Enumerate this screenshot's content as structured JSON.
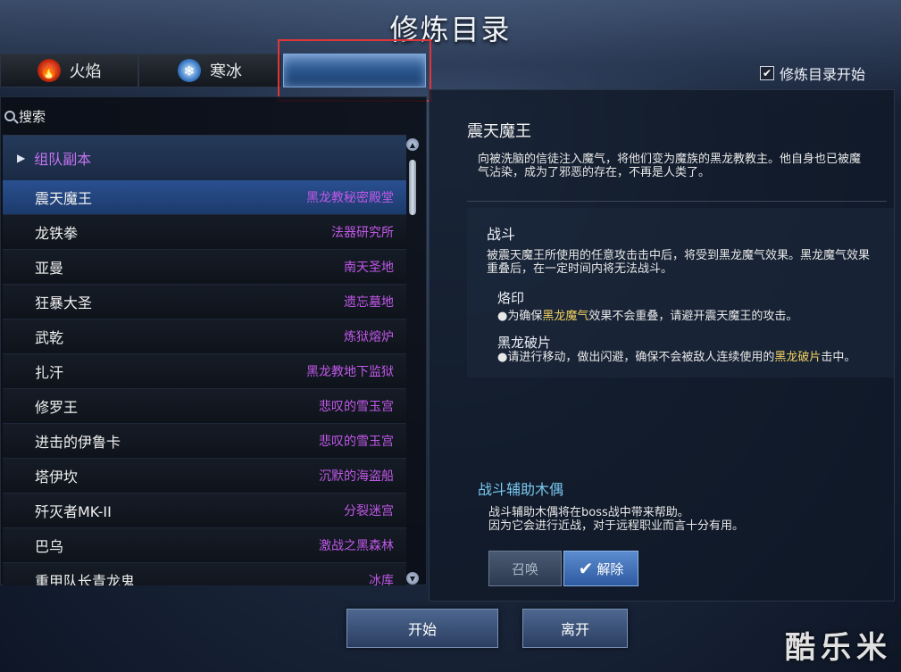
{
  "title": "修炼目录",
  "tabs": [
    {
      "label": "火焰",
      "icon": "fire-icon"
    },
    {
      "label": "寒冰",
      "icon": "snowflake-icon"
    },
    {
      "label": ""
    }
  ],
  "start_option": {
    "label": "修炼目录开始",
    "checked": true
  },
  "search": {
    "placeholder": "搜索"
  },
  "group": {
    "label": "组队副本"
  },
  "bosses": [
    {
      "name": "震天魔王",
      "location": "黑龙教秘密殿堂",
      "selected": true
    },
    {
      "name": "龙铁拳",
      "location": "法器研究所"
    },
    {
      "name": "亚曼",
      "location": "南天圣地"
    },
    {
      "name": "狂暴大圣",
      "location": "遗忘墓地"
    },
    {
      "name": "武乾",
      "location": "炼狱熔炉"
    },
    {
      "name": "扎汗",
      "location": "黑龙教地下监狱"
    },
    {
      "name": "修罗王",
      "location": "悲叹的雪玉宫"
    },
    {
      "name": "进击的伊鲁卡",
      "location": "悲叹的雪玉宫"
    },
    {
      "name": "塔伊坎",
      "location": "沉默的海盗船"
    },
    {
      "name": "歼灭者MK-II",
      "location": "分裂迷宫"
    },
    {
      "name": "巴乌",
      "location": "激战之黑森林"
    },
    {
      "name": "重甲队长青龙鬼",
      "location": "冰库"
    }
  ],
  "detail": {
    "title": "震天魔王",
    "description": "向被洗脑的信徒注入魔气，将他们变为魔族的黑龙教教主。他自身也已被魔气沾染，成为了邪恶的存在，不再是人类了。",
    "battle": {
      "title": "战斗",
      "description": "被震天魔王所使用的任意攻击击中后，将受到黑龙魔气效果。黑龙魔气效果重叠后，在一定时间内将无法战斗。",
      "mechanics": [
        {
          "title": "烙印",
          "text_before": "●为确保",
          "highlight": "黑龙魔气",
          "text_after": "效果不会重叠，请避开震天魔王的攻击。"
        },
        {
          "title": "黑龙破片",
          "text_before": "●请进行移动，做出闪避，确保不会被敌人连续使用的",
          "highlight": "黑龙破片",
          "text_after": "击中。"
        }
      ]
    },
    "puppet": {
      "title": "战斗辅助木偶",
      "description_line1": "战斗辅助木偶将在boss战中带来帮助。",
      "description_line2": "因为它会进行近战，对于远程职业而言十分有用。",
      "summon_label": "召唤",
      "release_label": "解除"
    }
  },
  "buttons": {
    "start": "开始",
    "leave": "离开"
  },
  "watermark": "酷乐米",
  "colors": {
    "location": "#c058e8",
    "group": "#c472f0",
    "highlight": "#f2d060",
    "puppet_title": "#7ac8f0",
    "selected_row": "#2a5090"
  }
}
